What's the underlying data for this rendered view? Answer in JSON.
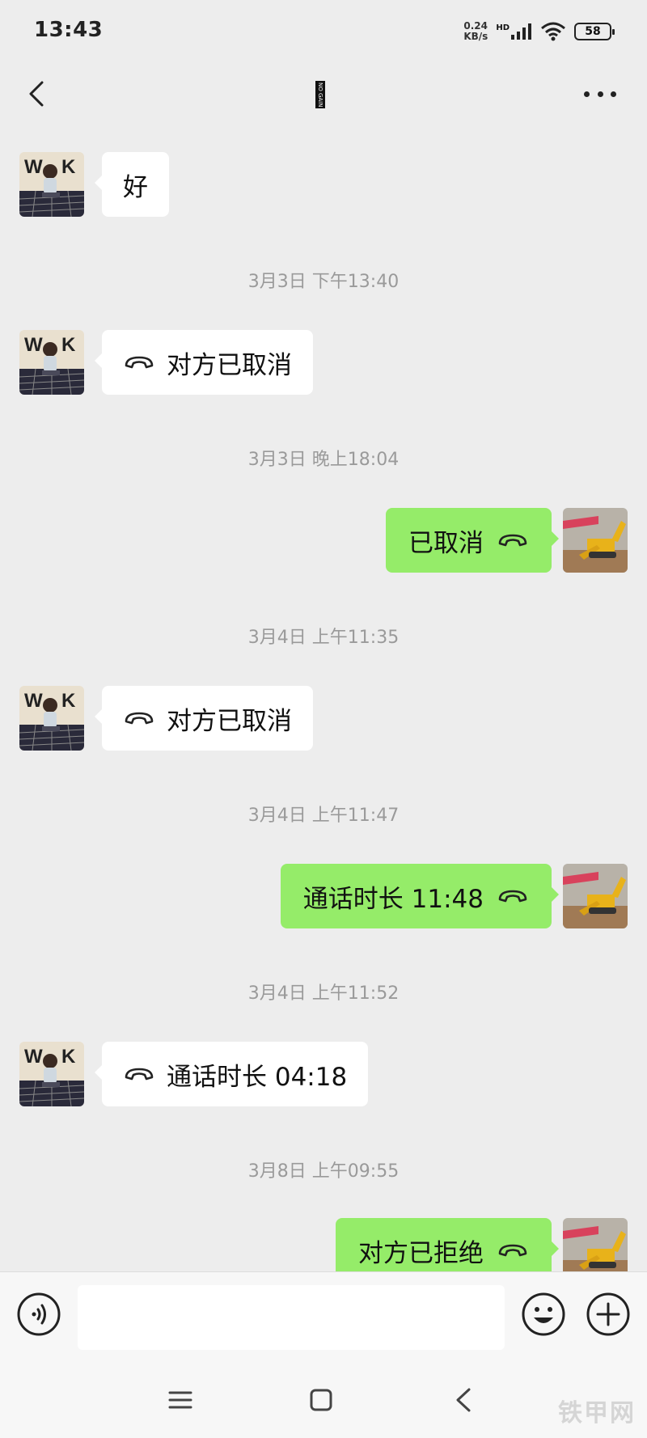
{
  "status_bar": {
    "time": "13:43",
    "net_speed_value": "0.24",
    "net_speed_unit": "KB/s",
    "hd_label": "HD",
    "battery": "58"
  },
  "header": {
    "title": "NO GAIN"
  },
  "messages": [
    {
      "side": "in",
      "text": "好"
    },
    {
      "timestamp": "3月3日 下午13:40"
    },
    {
      "side": "in",
      "text": "对方已取消",
      "call_icon": "hangup-phone-icon"
    },
    {
      "timestamp": "3月3日 晚上18:04"
    },
    {
      "side": "out",
      "text": "已取消",
      "call_icon": "hangup-phone-icon"
    },
    {
      "timestamp": "3月4日 上午11:35"
    },
    {
      "side": "in",
      "text": "对方已取消",
      "call_icon": "hangup-phone-icon"
    },
    {
      "timestamp": "3月4日 上午11:47"
    },
    {
      "side": "out",
      "text": "通话时长 11:48",
      "call_icon": "hangup-phone-icon"
    },
    {
      "timestamp": "3月4日 上午11:52"
    },
    {
      "side": "in",
      "text": "通话时长 04:18",
      "call_icon": "hangup-phone-icon"
    },
    {
      "timestamp": "3月8日 上午09:55"
    },
    {
      "side": "out",
      "text": "对方已拒绝",
      "call_icon": "hangup-phone-icon"
    }
  ],
  "input_bar": {
    "text_value": "",
    "icons": [
      "voice-icon",
      "emoji-icon",
      "add-icon"
    ]
  },
  "nav_bar": {
    "icons": [
      "menu-icon",
      "home-icon",
      "back-icon"
    ],
    "watermark": "铁甲网"
  },
  "avatars": {
    "incoming": "WORK",
    "outgoing": "excavator-photo"
  },
  "colors": {
    "background": "#ededed",
    "bubble_out": "#95ec69",
    "bubble_in": "#ffffff",
    "timestamp": "#9a9a9a"
  }
}
